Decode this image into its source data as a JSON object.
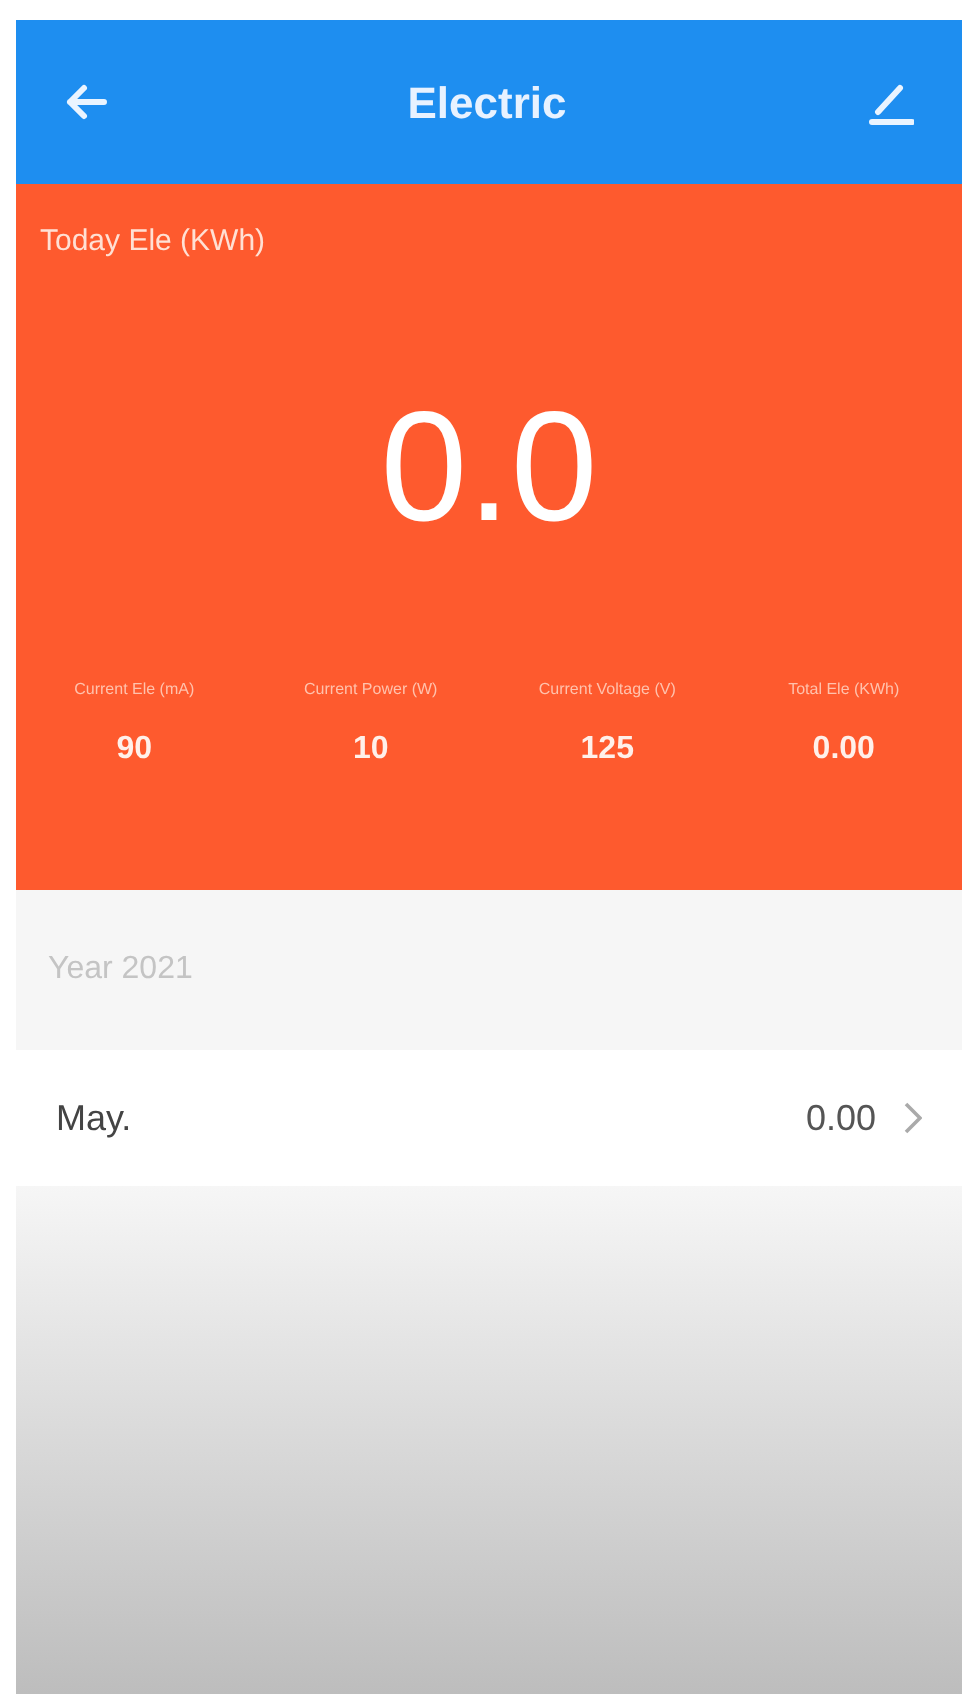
{
  "header": {
    "title": "Electric"
  },
  "today": {
    "label": "Today Ele (KWh)",
    "value": "0.0"
  },
  "stats": [
    {
      "label": "Current Ele (mA)",
      "value": "90"
    },
    {
      "label": "Current Power (W)",
      "value": "10"
    },
    {
      "label": "Current Voltage (V)",
      "value": "125"
    },
    {
      "label": "Total Ele (KWh)",
      "value": "0.00"
    }
  ],
  "year": {
    "label": "Year 2021"
  },
  "months": [
    {
      "label": "May.",
      "value": "0.00"
    }
  ]
}
